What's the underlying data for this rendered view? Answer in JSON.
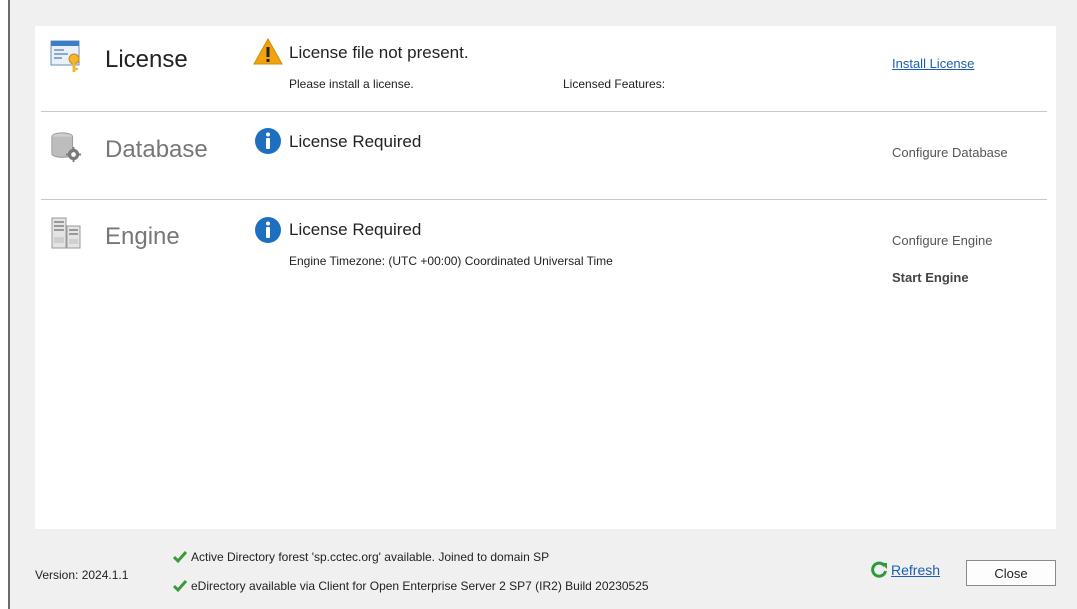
{
  "license": {
    "title": "License",
    "status": "License file not present.",
    "detail": "Please install a license.",
    "features_label": "Licensed Features:",
    "action": "Install License"
  },
  "database": {
    "title": "Database",
    "status": "License Required",
    "action": "Configure Database"
  },
  "engine": {
    "title": "Engine",
    "status": "License Required",
    "timezone": "Engine Timezone: (UTC +00:00)  Coordinated Universal Time",
    "action_configure": "Configure Engine",
    "action_start": "Start Engine"
  },
  "footer": {
    "version": "Version: 2024.1.1",
    "messages": [
      "Active Directory forest 'sp.cctec.org' available.  Joined to domain SP",
      "eDirectory available via Client for Open Enterprise Server 2 SP7 (IR2)  Build 20230525"
    ],
    "refresh": "Refresh",
    "close": "Close"
  },
  "colors": {
    "link": "#1a5fb4",
    "warning": "#f0a30a",
    "info": "#1e6fc0",
    "check": "#3a9a3a"
  }
}
